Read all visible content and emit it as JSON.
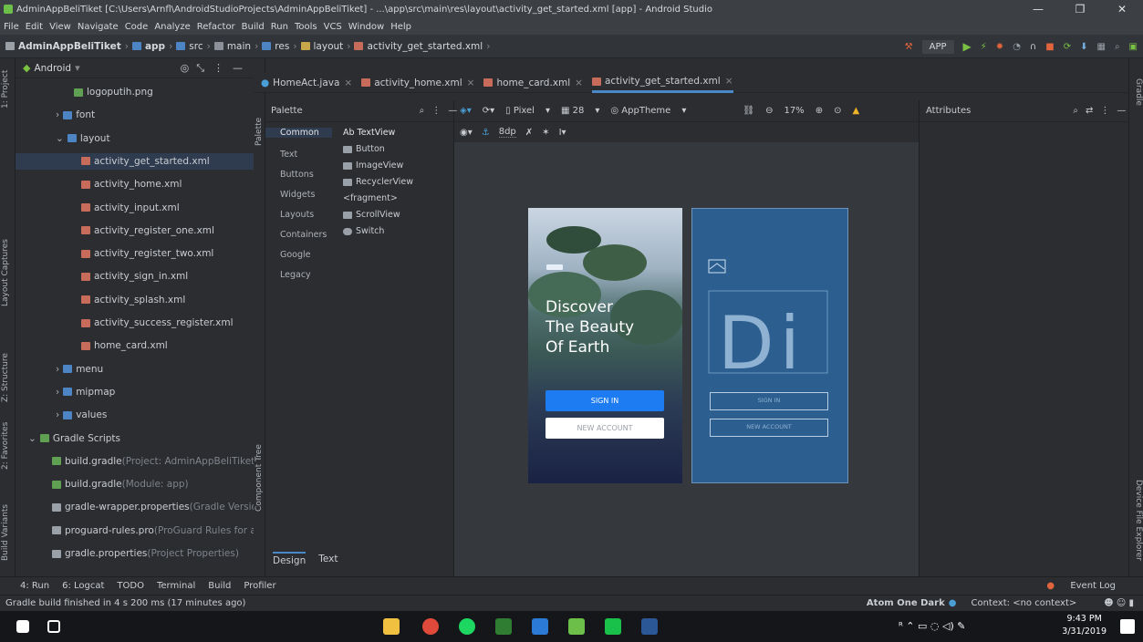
{
  "window": {
    "title": "AdminAppBeliTiket [C:\\Users\\Arnfl\\AndroidStudioProjects\\AdminAppBeliTiket] - ...\\app\\src\\main\\res\\layout\\activity_get_started.xml [app] - Android Studio",
    "min": "—",
    "max": "❐",
    "close": "✕"
  },
  "menu": [
    "File",
    "Edit",
    "View",
    "Navigate",
    "Code",
    "Analyze",
    "Refactor",
    "Build",
    "Run",
    "Tools",
    "VCS",
    "Window",
    "Help"
  ],
  "breadcrumb": [
    "AdminAppBeliTiket",
    "app",
    "src",
    "main",
    "res",
    "layout",
    "activity_get_started.xml"
  ],
  "run_config": "APP",
  "left_tools": [
    "1: Project",
    "Layout Captures",
    "Z: Structure",
    "2: Favorites",
    "Build Variants"
  ],
  "right_tools": [
    "Gradle",
    "Device File Explorer"
  ],
  "project": {
    "view": "Android",
    "items": [
      {
        "label": "logoputih.png",
        "indent": 64,
        "type": "png"
      },
      {
        "label": "font",
        "indent": 44,
        "type": "folder",
        "arrow": "›"
      },
      {
        "label": "layout",
        "indent": 44,
        "type": "folder",
        "arrow": "⌄"
      },
      {
        "label": "activity_get_started.xml",
        "indent": 72,
        "type": "xml",
        "sel": true
      },
      {
        "label": "activity_home.xml",
        "indent": 72,
        "type": "xml"
      },
      {
        "label": "activity_input.xml",
        "indent": 72,
        "type": "xml"
      },
      {
        "label": "activity_register_one.xml",
        "indent": 72,
        "type": "xml"
      },
      {
        "label": "activity_register_two.xml",
        "indent": 72,
        "type": "xml"
      },
      {
        "label": "activity_sign_in.xml",
        "indent": 72,
        "type": "xml"
      },
      {
        "label": "activity_splash.xml",
        "indent": 72,
        "type": "xml"
      },
      {
        "label": "activity_success_register.xml",
        "indent": 72,
        "type": "xml"
      },
      {
        "label": "home_card.xml",
        "indent": 72,
        "type": "xml"
      },
      {
        "label": "menu",
        "indent": 44,
        "type": "folder",
        "arrow": "›"
      },
      {
        "label": "mipmap",
        "indent": 44,
        "type": "folder",
        "arrow": "›"
      },
      {
        "label": "values",
        "indent": 44,
        "type": "folder",
        "arrow": "›"
      },
      {
        "label": "Gradle Scripts",
        "indent": 14,
        "type": "gradle",
        "arrow": "⌄"
      },
      {
        "label": "build.gradle",
        "muted": " (Project: AdminAppBeliTiket",
        "indent": 40,
        "type": "gradle"
      },
      {
        "label": "build.gradle",
        "muted": " (Module: app)",
        "indent": 40,
        "type": "gradle"
      },
      {
        "label": "gradle-wrapper.properties",
        "muted": " (Gradle Versio",
        "indent": 40,
        "type": "prop"
      },
      {
        "label": "proguard-rules.pro",
        "muted": " (ProGuard Rules for a",
        "indent": 40,
        "type": "prop"
      },
      {
        "label": "gradle.properties",
        "muted": " (Project Properties)",
        "indent": 40,
        "type": "prop"
      }
    ]
  },
  "tabs": [
    "HomeAct.java",
    "activity_home.xml",
    "home_card.xml",
    "activity_get_started.xml"
  ],
  "palette": {
    "title": "Palette",
    "side": "Palette",
    "tree_label": "Component Tree",
    "categories": [
      "Common",
      "Text",
      "Buttons",
      "Widgets",
      "Layouts",
      "Containers",
      "Google",
      "Legacy"
    ],
    "items": [
      "Ab TextView",
      "Button",
      "ImageView",
      "RecyclerView",
      "<fragment>",
      "ScrollView",
      "Switch"
    ],
    "tabs": [
      "Design",
      "Text"
    ]
  },
  "design_toolbar": {
    "device": "Pixel",
    "api": "28",
    "theme": "AppTheme",
    "zoom": "17%",
    "margin": "8dp"
  },
  "preview": {
    "heading": [
      "Discover",
      "The Beauty",
      "Of Earth"
    ],
    "sign_in": "SIGN IN",
    "new_account": "NEW ACCOUNT",
    "bp_text": "Di"
  },
  "attributes": {
    "title": "Attributes"
  },
  "bottom_tools": [
    "4: Run",
    "6: Logcat",
    "TODO",
    "Terminal",
    "Build",
    "Profiler"
  ],
  "event_log": "Event Log",
  "status": {
    "message": "Gradle build finished in 4 s 200 ms (17 minutes ago)",
    "theme": "Atom One Dark",
    "context": "Context: <no context>"
  },
  "clock": {
    "time": "9:43 PM",
    "date": "3/31/2019"
  },
  "colors": {
    "accent": "#1e7cf2",
    "blueprint": "#2c5f8f",
    "ide_bg": "#2b2d30"
  }
}
